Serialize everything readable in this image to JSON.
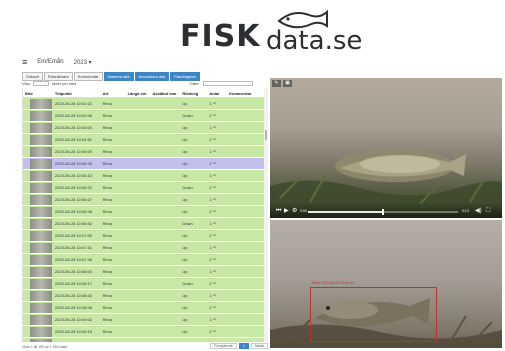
{
  "brand": {
    "part1": "FISK",
    "part2": "data.se"
  },
  "topbar": {
    "location": "Em/Emån",
    "year": "2023"
  },
  "tabs": [
    {
      "label": "Söksvit"
    },
    {
      "label": "Fiskräknare"
    },
    {
      "label": "Kommentar"
    },
    {
      "label": "Markera alla"
    },
    {
      "label": "Avmarkera alla"
    },
    {
      "label": "Fiskdiagram"
    }
  ],
  "filters": {
    "show_label": "Visa",
    "entries_label": "rader per sida",
    "date_label": "Date:"
  },
  "table": {
    "headers": [
      "Bild",
      "Tidpunkt",
      "Art",
      "Längd cm",
      "Avstånd mm",
      "Riktning",
      "Antal",
      "Kommentar"
    ],
    "rows": [
      {
        "time": "2023-06-28 10:02:21",
        "species": "Rimu",
        "direction": "Up",
        "count": "1 ⁽¹⁾",
        "selected": false
      },
      {
        "time": "2023-06-28 10:02:46",
        "species": "Rimu",
        "direction": "Down",
        "count": "1 ⁽¹⁾",
        "selected": false
      },
      {
        "time": "2023-06-28 10:03:04",
        "species": "Rimu",
        "direction": "Up",
        "count": "1 ⁽¹⁾",
        "selected": false
      },
      {
        "time": "2023-06-28 10:04:51",
        "species": "Rimu",
        "direction": "Up",
        "count": "1 ⁽¹⁾",
        "selected": false
      },
      {
        "time": "2023-06-28 10:05:09",
        "species": "Rimu",
        "direction": "Up",
        "count": "1 ⁽¹⁾",
        "selected": false
      },
      {
        "time": "2023-06-28 10:05:43",
        "species": "Rimu",
        "direction": "Up",
        "count": "1 ⁽¹⁾",
        "selected": true
      },
      {
        "time": "2023-06-28 10:06:10",
        "species": "Rimu",
        "direction": "Up",
        "count": "1 ⁽¹⁾",
        "selected": false
      },
      {
        "time": "2023-06-28 10:06:22",
        "species": "Rimu",
        "direction": "Down",
        "count": "1 ⁽¹⁾",
        "selected": false
      },
      {
        "time": "2023-06-28 10:06:37",
        "species": "Rimu",
        "direction": "Up",
        "count": "1 ⁽¹⁾",
        "selected": false
      },
      {
        "time": "2023-06-28 10:06:48",
        "species": "Rimu",
        "direction": "Up",
        "count": "1 ⁽¹⁾",
        "selected": false
      },
      {
        "time": "2023-06-28 10:06:52",
        "species": "Rimu",
        "direction": "Down",
        "count": "1 ⁽¹⁾",
        "selected": false
      },
      {
        "time": "2023-06-28 10:07:09",
        "species": "Rimu",
        "direction": "Up",
        "count": "1 ⁽¹⁾",
        "selected": false
      },
      {
        "time": "2023-06-28 10:07:31",
        "species": "Rimu",
        "direction": "Up",
        "count": "1 ⁽¹⁾",
        "selected": false
      },
      {
        "time": "2023-06-28 10:07:46",
        "species": "Rimu",
        "direction": "Up",
        "count": "1 ⁽¹⁾",
        "selected": false
      },
      {
        "time": "2023-06-28 10:08:03",
        "species": "Rimu",
        "direction": "Up",
        "count": "1 ⁽¹⁾",
        "selected": false
      },
      {
        "time": "2023-06-28 10:08:17",
        "species": "Rimu",
        "direction": "Down",
        "count": "1 ⁽¹⁾",
        "selected": false
      },
      {
        "time": "2023-06-28 10:08:33",
        "species": "Rimu",
        "direction": "Up",
        "count": "1 ⁽¹⁾",
        "selected": false
      },
      {
        "time": "2023-06-28 10:08:48",
        "species": "Rimu",
        "direction": "Up",
        "count": "1 ⁽¹⁾",
        "selected": false
      },
      {
        "time": "2023-06-28 10:09:02",
        "species": "Rimu",
        "direction": "Up",
        "count": "1 ⁽¹⁾",
        "selected": false
      },
      {
        "time": "2023-06-28 10:09:15",
        "species": "Rimu",
        "direction": "Up",
        "count": "1 ⁽¹⁾",
        "selected": false
      },
      {
        "time": "2023-06-28 10:09:30",
        "species": "Rimu",
        "direction": "Up",
        "count": "1 ⁽¹⁾",
        "selected": false
      }
    ]
  },
  "footer": {
    "info": "Visar 1 till 100 av 1 234 rader",
    "prev": "Föregående",
    "page": "1",
    "next": "Nästa"
  },
  "video1": {
    "time_current": "0:00",
    "time_total": "0:13",
    "progress": 0.49
  },
  "video2": {
    "detection_label": "Rimu 2023-06-28 10:05:43"
  },
  "colors": {
    "row_green": "#c8e9a5",
    "row_selected": "#c3c0ec",
    "accent_blue": "#3d86c6",
    "bbox_red": "#c0312b"
  }
}
